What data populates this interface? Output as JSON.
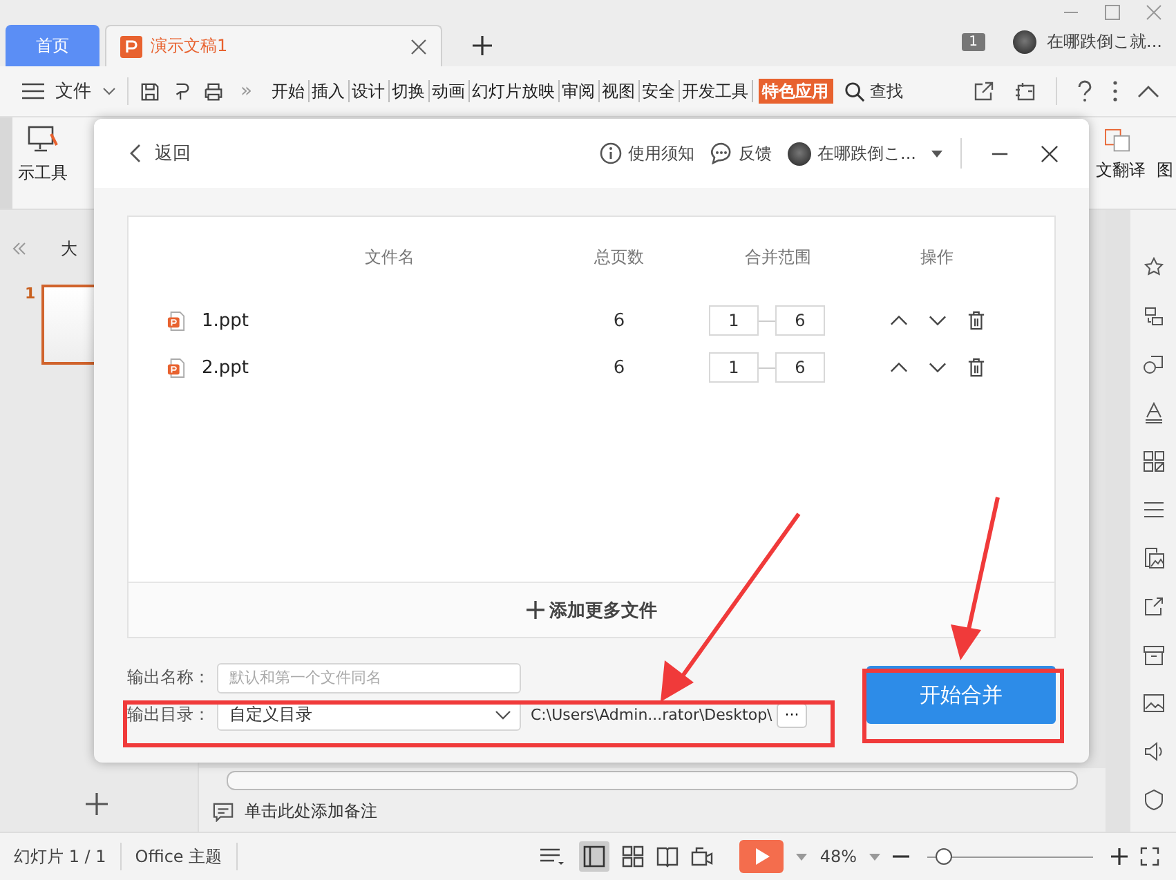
{
  "tabs": [
    {
      "label": "首页",
      "kind": "home",
      "selected": false
    },
    {
      "label": "演示文稿1",
      "kind": "doc",
      "selected": true
    }
  ],
  "account": {
    "badge": "1",
    "name": "在哪跌倒こ就..."
  },
  "menu": {
    "file": "文件",
    "more": "»",
    "tabs": [
      {
        "label": "开始",
        "selected": false
      },
      {
        "label": "插入",
        "selected": false
      },
      {
        "label": "设计",
        "selected": false
      },
      {
        "label": "切换",
        "selected": false
      },
      {
        "label": "动画",
        "selected": false
      },
      {
        "label": "幻灯片放映",
        "selected": false
      },
      {
        "label": "审阅",
        "selected": false
      },
      {
        "label": "视图",
        "selected": false
      },
      {
        "label": "安全",
        "selected": false
      },
      {
        "label": "开发工具",
        "selected": false
      },
      {
        "label": "特色应用",
        "selected": true
      }
    ],
    "search": "查找"
  },
  "ribbon": {
    "left_label": "示工具",
    "right_labels": [
      "文翻译",
      "图"
    ]
  },
  "outline": {
    "tab": "大",
    "slides": [
      {
        "number": "1",
        "selected": true
      }
    ]
  },
  "notes": {
    "placeholder": "单击此处添加备注"
  },
  "status_bar": {
    "slide": "幻灯片 1 / 1",
    "theme": "Office 主题",
    "zoom": "48%",
    "level": 0.1
  },
  "dialog": {
    "back": "返回",
    "help": "使用须知",
    "feedback": "反馈",
    "user": "在哪跌倒こ...",
    "columns": [
      "文件名",
      "总页数",
      "合并范围",
      "操作"
    ],
    "files": [
      {
        "name": "1.ppt",
        "pages": "6",
        "from": "1",
        "to": "6"
      },
      {
        "name": "2.ppt",
        "pages": "6",
        "from": "1",
        "to": "6"
      }
    ],
    "add_more": "添加更多文件",
    "output_name": {
      "label": "输出名称：",
      "placeholder": "默认和第一个文件同名"
    },
    "output_dir": {
      "label": "输出目录：",
      "value": "自定义目录",
      "path": "C:\\Users\\Admin...rator\\Desktop\\",
      "browse": "···"
    },
    "start": "开始合并"
  }
}
